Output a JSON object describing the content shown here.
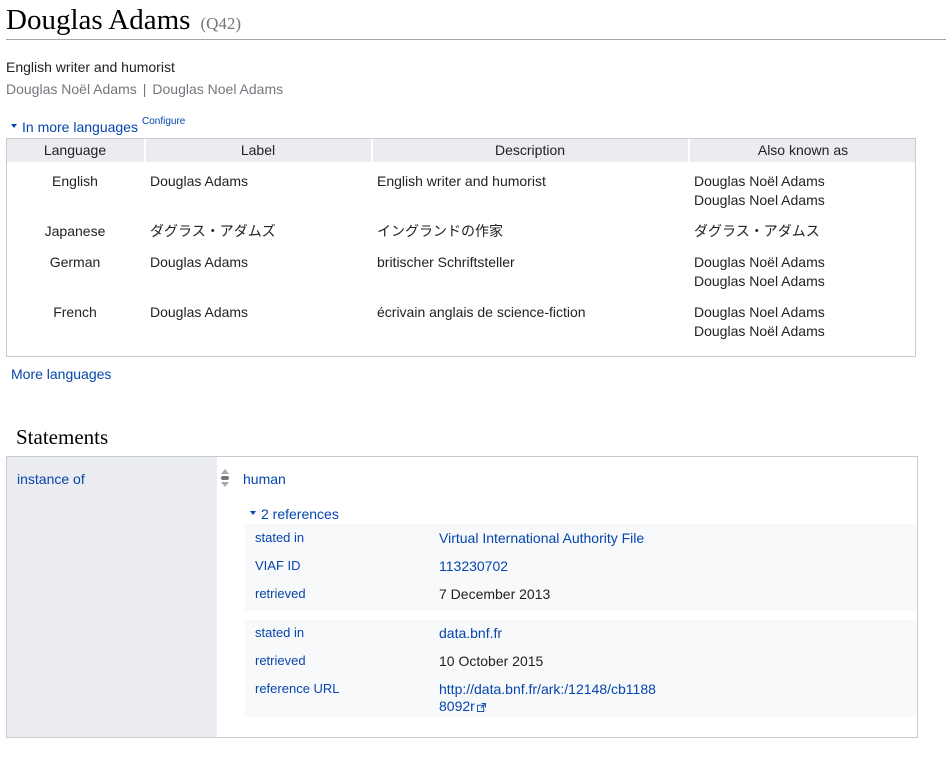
{
  "entity": {
    "label": "Douglas Adams",
    "id": "(Q42)",
    "description": "English writer and humorist",
    "aliases": [
      "Douglas Noël Adams",
      "Douglas Noel Adams"
    ],
    "alias_separator": "|"
  },
  "languages_section": {
    "toggle_label": "In more languages",
    "configure_label": "Configure",
    "headers": {
      "language": "Language",
      "label": "Label",
      "description": "Description",
      "aliases": "Also known as"
    },
    "rows": [
      {
        "language": "English",
        "label": "Douglas Adams",
        "description": "English writer and humorist",
        "aliases": [
          "Douglas Noël Adams",
          "Douglas Noel Adams"
        ]
      },
      {
        "language": "Japanese",
        "label": "ダグラス・アダムズ",
        "description": "イングランドの作家",
        "aliases": [
          "ダグラス・アダムス"
        ]
      },
      {
        "language": "German",
        "label": "Douglas Adams",
        "description": "britischer Schriftsteller",
        "aliases": [
          "Douglas Noël Adams",
          "Douglas Noel Adams"
        ]
      },
      {
        "language": "French",
        "label": "Douglas Adams",
        "description": "écrivain anglais de science-fiction",
        "aliases": [
          "Douglas Noel Adams",
          "Douglas Noël Adams"
        ]
      }
    ],
    "more_languages_label": "More languages"
  },
  "statements": {
    "title": "Statements",
    "property": "instance of",
    "value": "human",
    "references_toggle": "2 references",
    "references": [
      {
        "rows": [
          {
            "property": "stated in",
            "value": "Virtual International Authority File",
            "is_link": true
          },
          {
            "property": "VIAF ID",
            "value": "113230702",
            "is_link": true
          },
          {
            "property": "retrieved",
            "value": "7 December 2013",
            "is_link": false
          }
        ]
      },
      {
        "rows": [
          {
            "property": "stated in",
            "value": "data.bnf.fr",
            "is_link": true
          },
          {
            "property": "retrieved",
            "value": "10 October 2015",
            "is_link": false
          },
          {
            "property": "reference URL",
            "value_line1": "http://data.bnf.fr/ark:/12148/cb1188",
            "value_line2": "8092r",
            "is_link": true,
            "external": true
          }
        ]
      }
    ]
  },
  "icons": {
    "collapse_arrow": "triangle-down-icon",
    "rank": "normal-rank-icon",
    "external_link": "external-link-icon"
  },
  "colors": {
    "link": "#0645ad",
    "header_bg": "#eaecf0",
    "reference_bg": "#f8f9fa",
    "border": "#c8ccd1",
    "muted_text": "#72777d"
  }
}
